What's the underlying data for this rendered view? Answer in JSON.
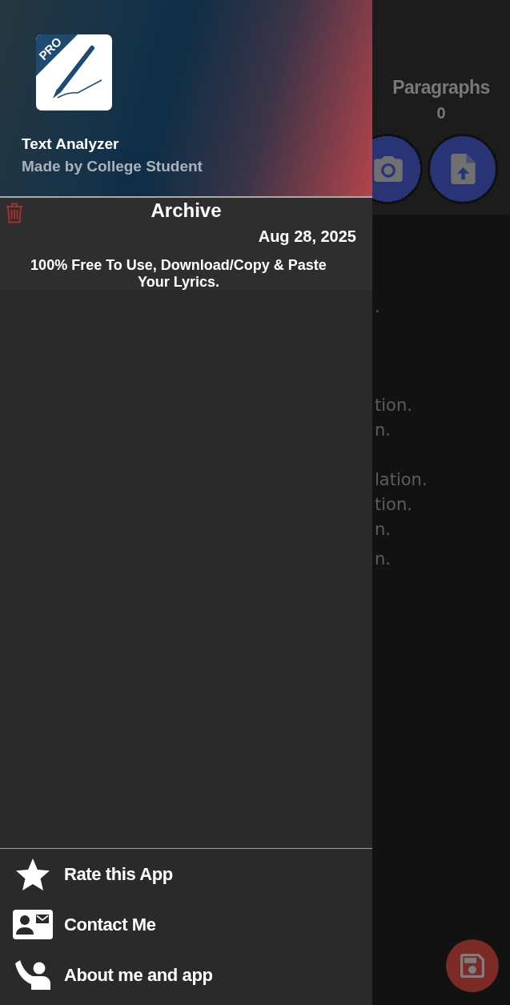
{
  "drawer": {
    "header": {
      "badge": "PRO",
      "title": "Text Analyzer",
      "subtitle": "Made by College Student"
    },
    "archive": {
      "title": "Archive",
      "date": "Aug 28, 2025",
      "text": "100% Free To Use, Download/Copy & Paste Your Lyrics."
    },
    "menu": [
      {
        "kind": "rate",
        "label": "Rate this App"
      },
      {
        "kind": "contact",
        "label": "Contact Me"
      },
      {
        "kind": "about",
        "label": "About me and app"
      }
    ]
  },
  "main": {
    "stat": {
      "label": "Paragraphs",
      "value": "0"
    },
    "text_lines": [
      ".",
      "tion.",
      "n.",
      "lation.",
      "tion.",
      "n.",
      "n."
    ]
  }
}
